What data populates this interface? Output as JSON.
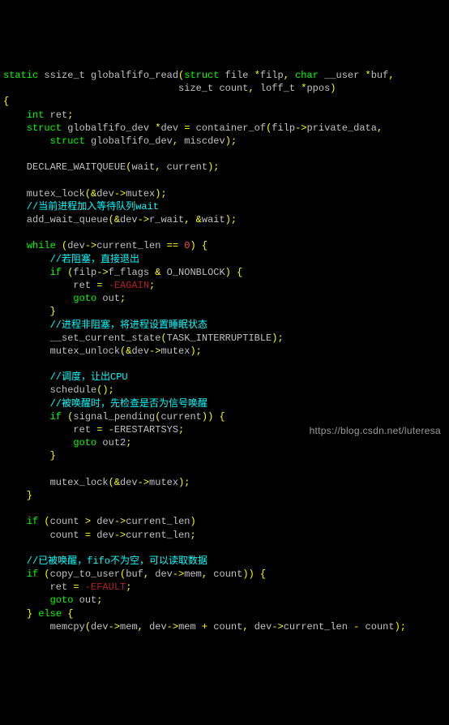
{
  "code": {
    "l1a": "static",
    "l1b": " ssize_t globalfifo_read",
    "l1p1": "(",
    "l1c": "struct",
    "l1d": " file ",
    "l1e": "*",
    "l1f": "filp",
    "l1g": ", ",
    "l1h": "char",
    "l1i": " __user ",
    "l1j": "*",
    "l1k": "buf",
    "l1l": ",",
    "l2a": "                              size_t count",
    "l2b": ", ",
    "l2c": "loff_t ",
    "l2d": "*",
    "l2e": "ppos",
    "l2p2": ")",
    "l3": "{",
    "l4a": "    ",
    "l4b": "int",
    "l4c": " ret",
    "l4d": ";",
    "l5a": "    ",
    "l5b": "struct",
    "l5c": " globalfifo_dev ",
    "l5d": "*",
    "l5e": "dev ",
    "l5f": "=",
    "l5g": " container_of",
    "l5p1": "(",
    "l5h": "filp",
    "l5i": "->",
    "l5j": "private_data",
    "l5k": ",",
    "l6a": "        ",
    "l6b": "struct",
    "l6c": " globalfifo_dev",
    "l6d": ", ",
    "l6e": "miscdev",
    "l6p2": ");",
    "l7": "",
    "l8a": "    DECLARE_WAITQUEUE",
    "l8p1": "(",
    "l8b": "wait",
    "l8c": ", ",
    "l8d": "current",
    "l8p2": ");",
    "l9": "",
    "l10a": "    mutex_lock",
    "l10p1": "(",
    "l10b": "&",
    "l10c": "dev",
    "l10d": "->",
    "l10e": "mutex",
    "l10p2": ");",
    "l11": "    //当前进程加入等待队列wait",
    "l12a": "    add_wait_queue",
    "l12p1": "(",
    "l12b": "&",
    "l12c": "dev",
    "l12d": "->",
    "l12e": "r_wait",
    "l12f": ", ",
    "l12g": "&",
    "l12h": "wait",
    "l12p2": ");",
    "l13": "",
    "l14a": "    ",
    "l14b": "while",
    "l14c": " ",
    "l14p1": "(",
    "l14d": "dev",
    "l14e": "->",
    "l14f": "current_len ",
    "l14g": "==",
    "l14h": " ",
    "l14i": "0",
    "l14p2": ")",
    "l14j": " ",
    "l14p3": "{",
    "l15": "        //若阻塞，直接退出",
    "l16a": "        ",
    "l16b": "if",
    "l16c": " ",
    "l16p1": "(",
    "l16d": "filp",
    "l16e": "->",
    "l16f": "f_flags ",
    "l16g": "&",
    "l16h": " O_NONBLOCK",
    "l16p2": ")",
    "l16i": " ",
    "l16p3": "{",
    "l17a": "            ret ",
    "l17b": "=",
    "l17c": " ",
    "l17d": "-EAGAIN",
    "l17e": ";",
    "l18a": "            ",
    "l18b": "goto",
    "l18c": " out",
    "l18d": ";",
    "l19": "        }",
    "l20": "        //进程非阻塞，将进程设置睡眠状态",
    "l21a": "        __set_current_state",
    "l21p1": "(",
    "l21b": "TASK_INTERRUPTIBLE",
    "l21p2": ");",
    "l22a": "        mutex_unlock",
    "l22p1": "(",
    "l22b": "&",
    "l22c": "dev",
    "l22d": "->",
    "l22e": "mutex",
    "l22p2": ");",
    "l23": "",
    "l24": "        //调度，让出CPU",
    "l25a": "        schedule",
    "l25p1": "();",
    "l26": "        //被唤醒时，先检查是否为信号唤醒",
    "l27a": "        ",
    "l27b": "if",
    "l27c": " ",
    "l27p1": "(",
    "l27d": "signal_pending",
    "l27p2": "(",
    "l27e": "current",
    "l27p3": "))",
    "l27f": " ",
    "l27p4": "{",
    "l28a": "            ret ",
    "l28b": "=",
    "l28c": " ",
    "l28d": "-",
    "l28e": "ERESTARTSYS",
    "l28f": ";",
    "l29a": "            ",
    "l29b": "goto",
    "l29c": " out2",
    "l29d": ";",
    "l30": "        }",
    "l31": "",
    "l32a": "        mutex_lock",
    "l32p1": "(",
    "l32b": "&",
    "l32c": "dev",
    "l32d": "->",
    "l32e": "mutex",
    "l32p2": ");",
    "l33": "    }",
    "l34": "",
    "l35a": "    ",
    "l35b": "if",
    "l35c": " ",
    "l35p1": "(",
    "l35d": "count ",
    "l35e": ">",
    "l35f": " dev",
    "l35g": "->",
    "l35h": "current_len",
    "l35p2": ")",
    "l36a": "        count ",
    "l36b": "=",
    "l36c": " dev",
    "l36d": "->",
    "l36e": "current_len",
    "l36f": ";",
    "l37": "",
    "l38": "    //已被唤醒，fifo不为空，可以读取数据",
    "l39a": "    ",
    "l39b": "if",
    "l39c": " ",
    "l39p1": "(",
    "l39d": "copy_to_user",
    "l39p2": "(",
    "l39e": "buf",
    "l39f": ", ",
    "l39g": "dev",
    "l39h": "->",
    "l39i": "mem",
    "l39j": ", ",
    "l39k": "count",
    "l39p3": "))",
    "l39l": " ",
    "l39p4": "{",
    "l40a": "        ret ",
    "l40b": "=",
    "l40c": " ",
    "l40d": "-EFAULT",
    "l40e": ";",
    "l41a": "        ",
    "l41b": "goto",
    "l41c": " out",
    "l41d": ";",
    "l42a": "    ",
    "l42p1": "}",
    "l42b": " ",
    "l42c": "else",
    "l42d": " ",
    "l42p2": "{",
    "l43a": "        memcpy",
    "l43p1": "(",
    "l43b": "dev",
    "l43c": "->",
    "l43d": "mem",
    "l43e": ", ",
    "l43f": "dev",
    "l43g": "->",
    "l43h": "mem ",
    "l43i": "+",
    "l43j": " count",
    "l43k": ", ",
    "l43l": "dev",
    "l43m": "->",
    "l43n": "current_len ",
    "l43o": "-",
    "l43p": " count",
    "l43p2": ");"
  },
  "watermark": "https://blog.csdn.net/luteresa"
}
